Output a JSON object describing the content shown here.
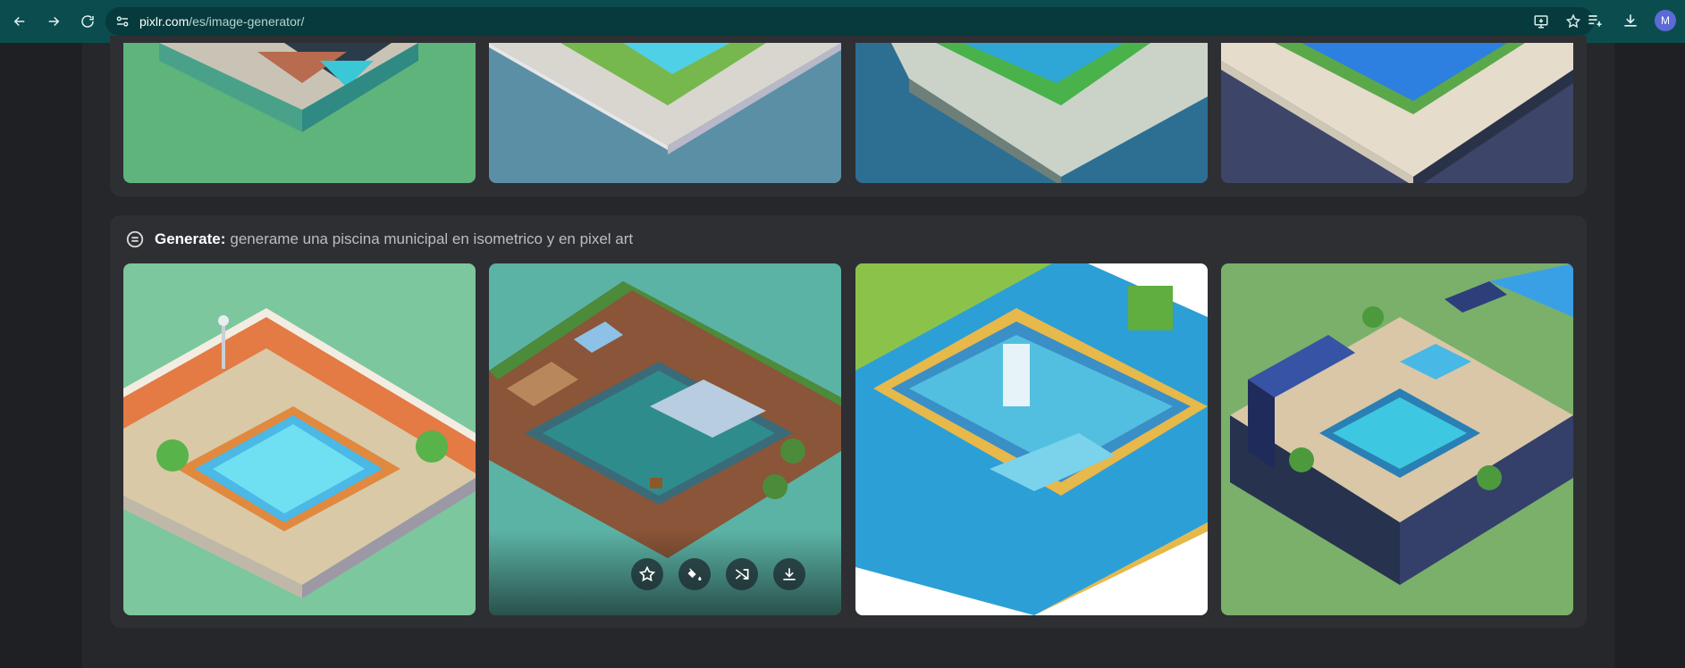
{
  "browser": {
    "url_domain": "pixlr.com",
    "url_path": "/es/image-generator/",
    "avatar_letter": "M"
  },
  "generation": {
    "label": "Generate:",
    "prompt": "generame una piscina municipal en isometrico y en pixel art"
  },
  "icons": {
    "back": "arrow-left-icon",
    "forward": "arrow-right-icon",
    "reload": "reload-icon",
    "site_info": "tune-icon",
    "cast": "install-app-icon",
    "bookmark": "star-icon",
    "reading_list": "reading-list-icon",
    "downloads": "download-icon",
    "prompt": "chat-bubble-icon",
    "favorite": "star-icon",
    "fill": "paint-bucket-icon",
    "shuffle": "shuffle-icon",
    "download": "download-icon"
  },
  "colors": {
    "chrome_bg": "#0b4d4f",
    "page_bg": "#1f2023",
    "card_bg": "#2e2f33"
  }
}
